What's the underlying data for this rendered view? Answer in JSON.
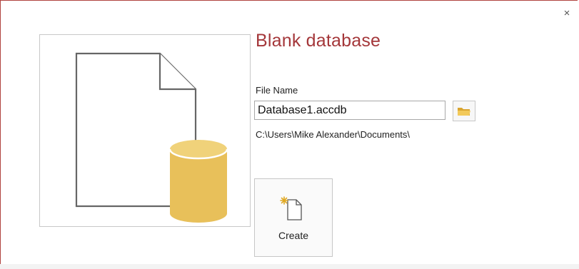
{
  "dialog": {
    "title": "Blank database",
    "close_label": "×"
  },
  "form": {
    "file_name_label": "File Name",
    "file_name_value": "Database1.accdb",
    "save_path": "C:\\Users\\Mike Alexander\\Documents\\"
  },
  "actions": {
    "create_label": "Create"
  },
  "icons": {
    "preview": "blank-document-database-icon",
    "browse": "folder-icon",
    "create": "new-document-icon",
    "close": "close-icon"
  },
  "colors": {
    "title": "#a4373a",
    "database_cylinder": "#e8c05a",
    "folder": "#e4b540"
  }
}
